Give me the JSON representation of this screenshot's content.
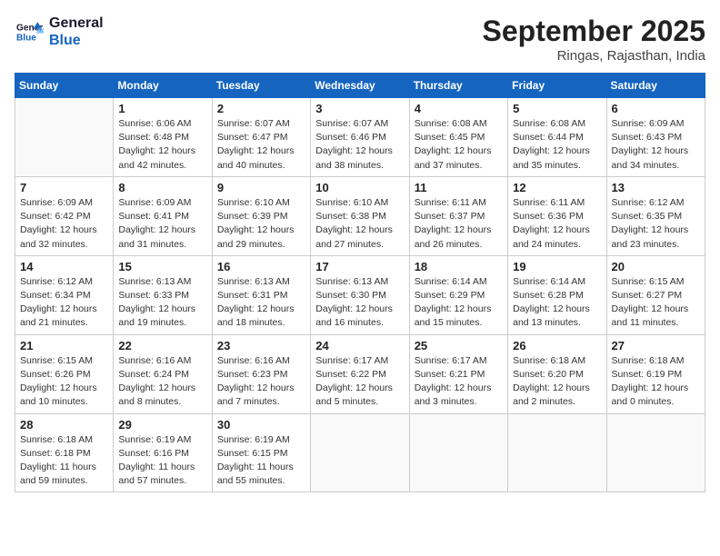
{
  "logo": {
    "line1": "General",
    "line2": "Blue"
  },
  "title": "September 2025",
  "subtitle": "Ringas, Rajasthan, India",
  "days_of_week": [
    "Sunday",
    "Monday",
    "Tuesday",
    "Wednesday",
    "Thursday",
    "Friday",
    "Saturday"
  ],
  "weeks": [
    [
      {
        "day": "",
        "info": ""
      },
      {
        "day": "1",
        "info": "Sunrise: 6:06 AM\nSunset: 6:48 PM\nDaylight: 12 hours\nand 42 minutes."
      },
      {
        "day": "2",
        "info": "Sunrise: 6:07 AM\nSunset: 6:47 PM\nDaylight: 12 hours\nand 40 minutes."
      },
      {
        "day": "3",
        "info": "Sunrise: 6:07 AM\nSunset: 6:46 PM\nDaylight: 12 hours\nand 38 minutes."
      },
      {
        "day": "4",
        "info": "Sunrise: 6:08 AM\nSunset: 6:45 PM\nDaylight: 12 hours\nand 37 minutes."
      },
      {
        "day": "5",
        "info": "Sunrise: 6:08 AM\nSunset: 6:44 PM\nDaylight: 12 hours\nand 35 minutes."
      },
      {
        "day": "6",
        "info": "Sunrise: 6:09 AM\nSunset: 6:43 PM\nDaylight: 12 hours\nand 34 minutes."
      }
    ],
    [
      {
        "day": "7",
        "info": "Sunrise: 6:09 AM\nSunset: 6:42 PM\nDaylight: 12 hours\nand 32 minutes."
      },
      {
        "day": "8",
        "info": "Sunrise: 6:09 AM\nSunset: 6:41 PM\nDaylight: 12 hours\nand 31 minutes."
      },
      {
        "day": "9",
        "info": "Sunrise: 6:10 AM\nSunset: 6:39 PM\nDaylight: 12 hours\nand 29 minutes."
      },
      {
        "day": "10",
        "info": "Sunrise: 6:10 AM\nSunset: 6:38 PM\nDaylight: 12 hours\nand 27 minutes."
      },
      {
        "day": "11",
        "info": "Sunrise: 6:11 AM\nSunset: 6:37 PM\nDaylight: 12 hours\nand 26 minutes."
      },
      {
        "day": "12",
        "info": "Sunrise: 6:11 AM\nSunset: 6:36 PM\nDaylight: 12 hours\nand 24 minutes."
      },
      {
        "day": "13",
        "info": "Sunrise: 6:12 AM\nSunset: 6:35 PM\nDaylight: 12 hours\nand 23 minutes."
      }
    ],
    [
      {
        "day": "14",
        "info": "Sunrise: 6:12 AM\nSunset: 6:34 PM\nDaylight: 12 hours\nand 21 minutes."
      },
      {
        "day": "15",
        "info": "Sunrise: 6:13 AM\nSunset: 6:33 PM\nDaylight: 12 hours\nand 19 minutes."
      },
      {
        "day": "16",
        "info": "Sunrise: 6:13 AM\nSunset: 6:31 PM\nDaylight: 12 hours\nand 18 minutes."
      },
      {
        "day": "17",
        "info": "Sunrise: 6:13 AM\nSunset: 6:30 PM\nDaylight: 12 hours\nand 16 minutes."
      },
      {
        "day": "18",
        "info": "Sunrise: 6:14 AM\nSunset: 6:29 PM\nDaylight: 12 hours\nand 15 minutes."
      },
      {
        "day": "19",
        "info": "Sunrise: 6:14 AM\nSunset: 6:28 PM\nDaylight: 12 hours\nand 13 minutes."
      },
      {
        "day": "20",
        "info": "Sunrise: 6:15 AM\nSunset: 6:27 PM\nDaylight: 12 hours\nand 11 minutes."
      }
    ],
    [
      {
        "day": "21",
        "info": "Sunrise: 6:15 AM\nSunset: 6:26 PM\nDaylight: 12 hours\nand 10 minutes."
      },
      {
        "day": "22",
        "info": "Sunrise: 6:16 AM\nSunset: 6:24 PM\nDaylight: 12 hours\nand 8 minutes."
      },
      {
        "day": "23",
        "info": "Sunrise: 6:16 AM\nSunset: 6:23 PM\nDaylight: 12 hours\nand 7 minutes."
      },
      {
        "day": "24",
        "info": "Sunrise: 6:17 AM\nSunset: 6:22 PM\nDaylight: 12 hours\nand 5 minutes."
      },
      {
        "day": "25",
        "info": "Sunrise: 6:17 AM\nSunset: 6:21 PM\nDaylight: 12 hours\nand 3 minutes."
      },
      {
        "day": "26",
        "info": "Sunrise: 6:18 AM\nSunset: 6:20 PM\nDaylight: 12 hours\nand 2 minutes."
      },
      {
        "day": "27",
        "info": "Sunrise: 6:18 AM\nSunset: 6:19 PM\nDaylight: 12 hours\nand 0 minutes."
      }
    ],
    [
      {
        "day": "28",
        "info": "Sunrise: 6:18 AM\nSunset: 6:18 PM\nDaylight: 11 hours\nand 59 minutes."
      },
      {
        "day": "29",
        "info": "Sunrise: 6:19 AM\nSunset: 6:16 PM\nDaylight: 11 hours\nand 57 minutes."
      },
      {
        "day": "30",
        "info": "Sunrise: 6:19 AM\nSunset: 6:15 PM\nDaylight: 11 hours\nand 55 minutes."
      },
      {
        "day": "",
        "info": ""
      },
      {
        "day": "",
        "info": ""
      },
      {
        "day": "",
        "info": ""
      },
      {
        "day": "",
        "info": ""
      }
    ]
  ]
}
